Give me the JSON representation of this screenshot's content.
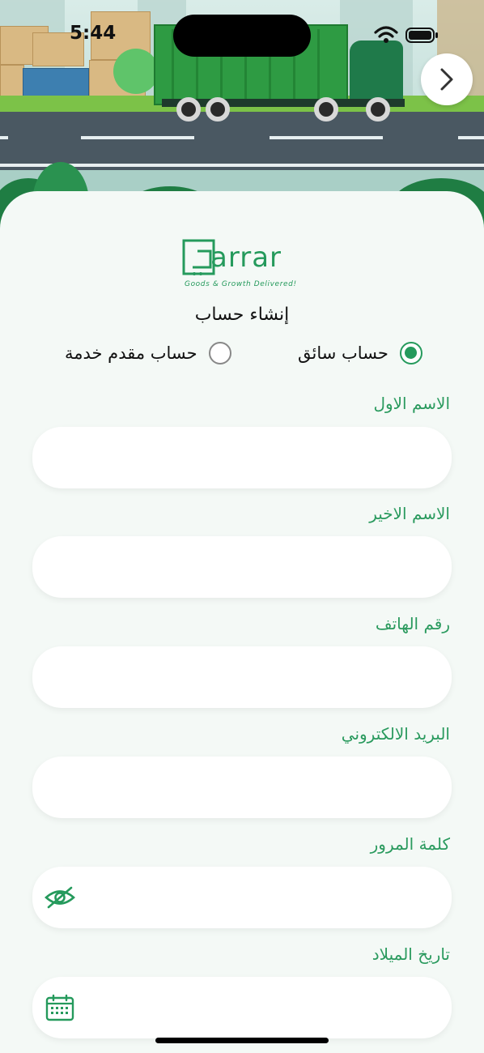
{
  "status_bar": {
    "time": "5:44"
  },
  "logo": {
    "word": "arrar",
    "tagline": "Goods & Growth Delivered!"
  },
  "page_title": "إنشاء حساب",
  "account_type": {
    "options": [
      {
        "label": "حساب سائق",
        "selected": true
      },
      {
        "label": "حساب مقدم خدمة",
        "selected": false
      }
    ]
  },
  "form": {
    "first_name": {
      "label": "الاسم الاول",
      "value": ""
    },
    "last_name": {
      "label": "الاسم الاخير",
      "value": ""
    },
    "phone": {
      "label": "رقم الهاتف",
      "value": ""
    },
    "email": {
      "label": "البريد الالكتروني",
      "value": ""
    },
    "password": {
      "label": "كلمة المرور",
      "value": "",
      "icon": "eye-slash-icon"
    },
    "birth_date": {
      "label": "تاريخ الميلاد",
      "value": "",
      "icon": "calendar-icon"
    }
  },
  "colors": {
    "accent": "#259a5c",
    "background": "#f4f9f6",
    "field": "#ffffff"
  }
}
